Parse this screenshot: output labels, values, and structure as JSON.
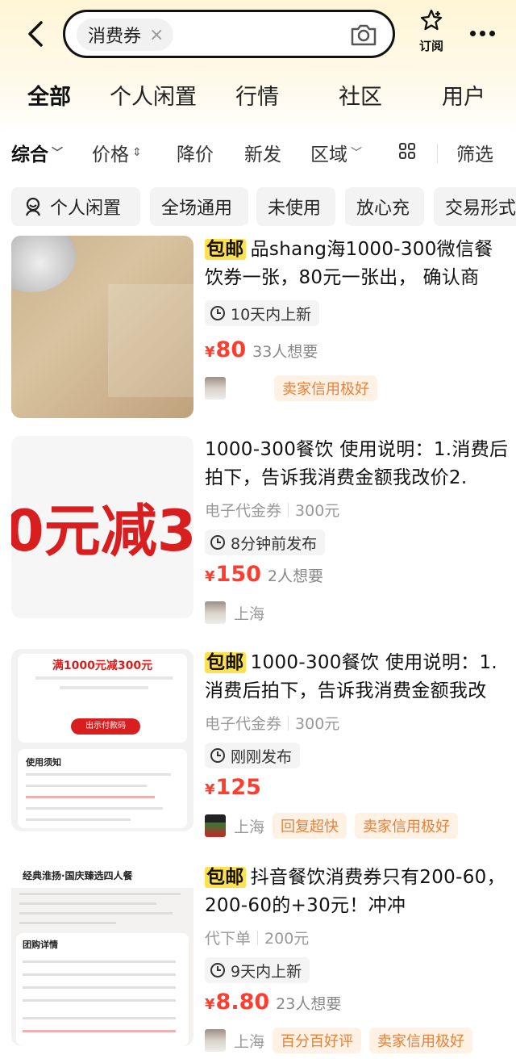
{
  "search": {
    "keyword": "消费券",
    "clear_symbol": "×"
  },
  "subscribe": {
    "label": "订阅"
  },
  "tabs": [
    {
      "label": "全部",
      "active": true
    },
    {
      "label": "个人闲置"
    },
    {
      "label": "行情"
    },
    {
      "label": "社区"
    },
    {
      "label": "用户"
    }
  ],
  "filters": {
    "sort": "综合",
    "price": "价格",
    "price_drop": "降价",
    "new": "新发",
    "region": "区域",
    "filter": "筛选"
  },
  "tags": [
    "个人闲置",
    "全场通用",
    "未使用",
    "放心充",
    "交易形式"
  ],
  "colors": {
    "accent": "#ffe14d",
    "price": "#ff3d2e",
    "credit_text": "#e8813a",
    "credit_bg": "#fff1e4"
  },
  "items": [
    {
      "badge": "包邮",
      "title": "品shang海1000-300微信餐饮券一张，80元一张出， 确认商",
      "time": "10天内上新",
      "price": "80",
      "want": "33人想要",
      "credit": "卖家信用极好"
    },
    {
      "title": "1000-300餐饮 使用说明：1.消费后拍下，告诉我消费金额我改价2.",
      "category": "电子代金券",
      "value": "300元",
      "thumb_text": "0元减3",
      "time": "8分钟前发布",
      "price": "150",
      "want": "2人想要",
      "location": "上海"
    },
    {
      "badge": "包邮",
      "title": "1000-300餐饮 使用说明：1.消费后拍下，告诉我消费金额我改",
      "category": "电子代金券",
      "value": "300元",
      "thumb_title": "满1000元减300元",
      "thumb_btn": "出示付款码",
      "thumb_section": "使用须知",
      "time": "刚刚发布",
      "price": "125",
      "location": "上海",
      "tag1": "回复超快",
      "credit": "卖家信用极好"
    },
    {
      "badge": "包邮",
      "title": "抖音餐饮消费券只有200-60，200-60的+30元！冲冲",
      "category": "代下单",
      "value": "200元",
      "thumb_title": "经典淮扬·国庆臻选四人餐",
      "thumb_section": "团购详情",
      "time": "9天内上新",
      "price": "8.80",
      "want": "23人想要",
      "location": "上海",
      "tag1": "百分百好评",
      "credit": "卖家信用极好"
    }
  ],
  "icons": [
    "back-arrow-icon",
    "camera-icon",
    "star-subscribe-icon",
    "more-icon",
    "chevron-down-icon",
    "sort-icon",
    "grid-icon",
    "person-icon",
    "clock-icon"
  ]
}
